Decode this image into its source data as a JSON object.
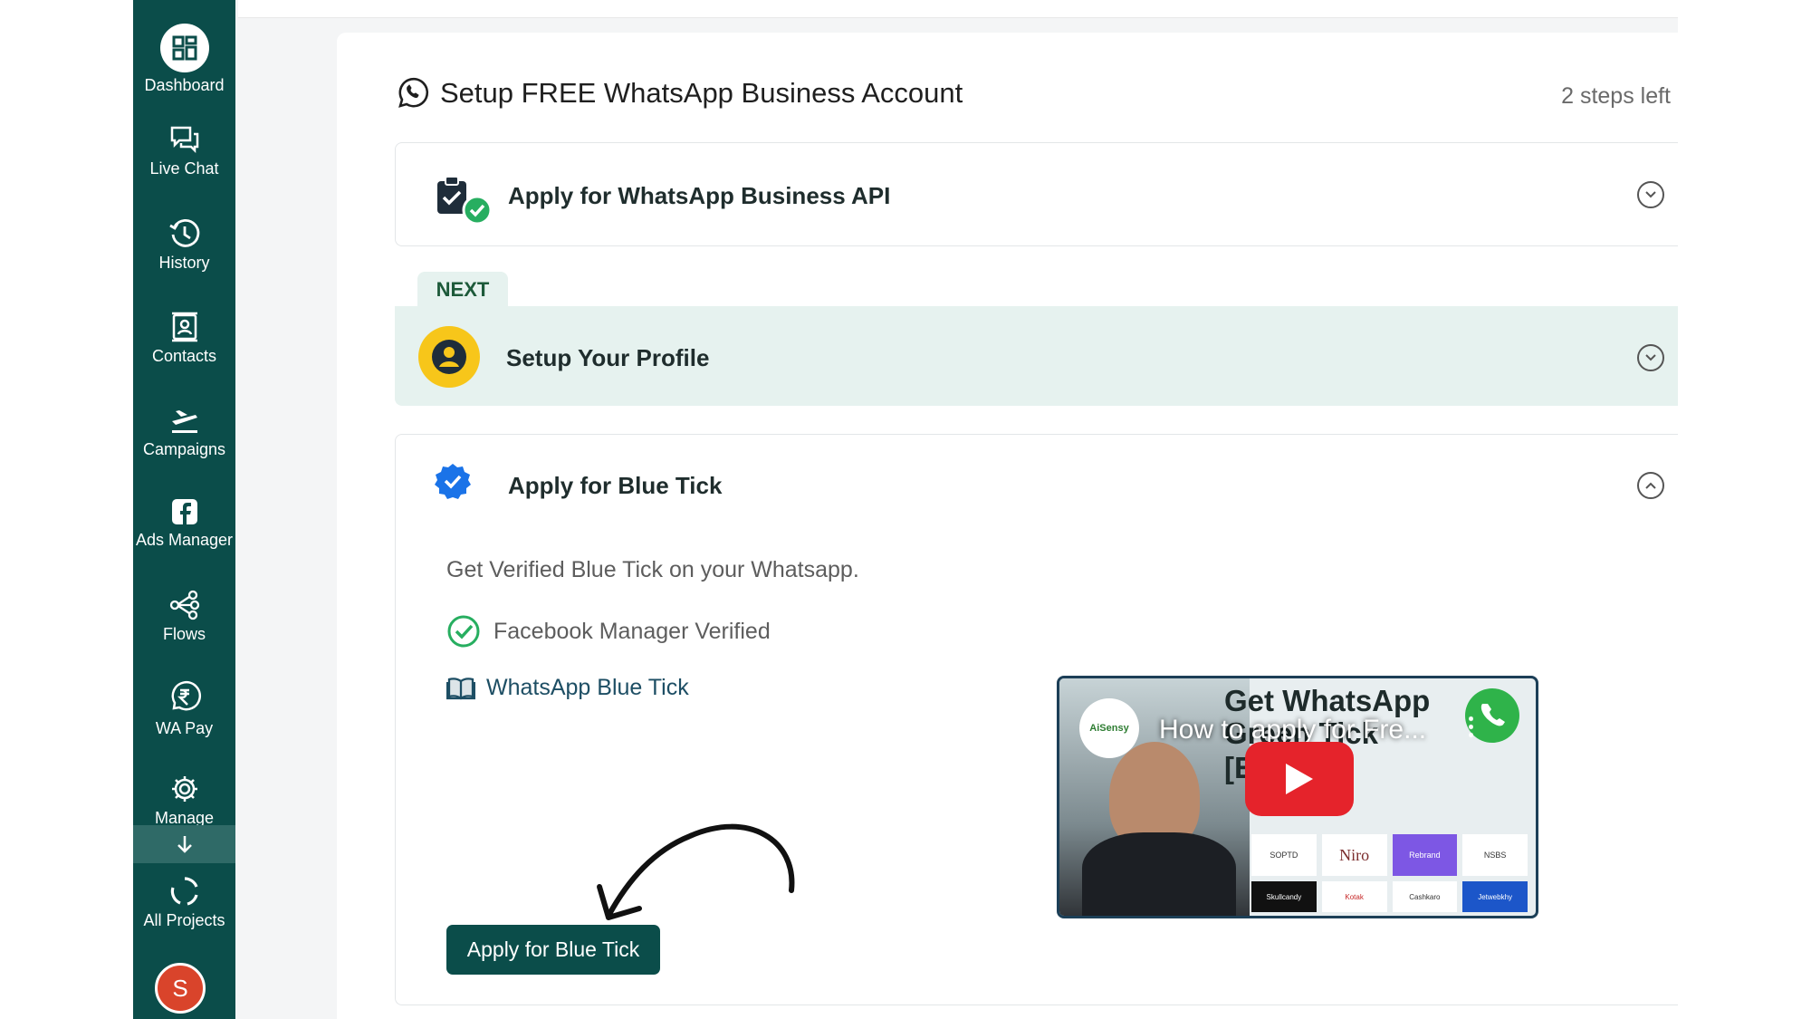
{
  "sidebar": {
    "items": [
      {
        "label": "Dashboard",
        "icon": "dashboard-icon"
      },
      {
        "label": "Live Chat",
        "icon": "chat-icon"
      },
      {
        "label": "History",
        "icon": "history-icon"
      },
      {
        "label": "Contacts",
        "icon": "contacts-icon"
      },
      {
        "label": "Campaigns",
        "icon": "campaigns-icon"
      },
      {
        "label": "Ads Manager",
        "icon": "facebook-icon"
      },
      {
        "label": "Flows",
        "icon": "flows-icon"
      },
      {
        "label": "WA Pay",
        "icon": "rupee-icon"
      },
      {
        "label": "Manage",
        "icon": "gear-icon"
      },
      {
        "label": "All Projects",
        "icon": "projects-icon"
      }
    ],
    "avatar_letter": "S"
  },
  "header": {
    "title": "Setup FREE WhatsApp Business Account",
    "steps_left": "2 steps left"
  },
  "steps": {
    "api": {
      "title": "Apply for WhatsApp Business API"
    },
    "next_badge": "NEXT",
    "profile": {
      "title": "Setup Your Profile"
    },
    "blue_tick": {
      "title": "Apply for Blue Tick",
      "description": "Get Verified Blue Tick on your Whatsapp.",
      "checklist_item": "Facebook Manager Verified",
      "link_label": "WhatsApp Blue Tick",
      "button_label": "Apply for Blue Tick"
    }
  },
  "video": {
    "title": "How to apply for Fre...",
    "thumbnail_heading_1": "Get WhatsApp",
    "thumbnail_heading_2": "Green Tick",
    "thumbnail_heading_3": "[English]",
    "channel": "AiSensy",
    "logos": [
      "SOPTD",
      "Niro",
      "Rebrand",
      "NSBS",
      "Skullcandy",
      "Kotak",
      "Cashkaro",
      "Jetwebkhy"
    ]
  },
  "colors": {
    "sidebar_bg": "#0b4d4a",
    "accent_green": "#27ae60",
    "blue_tick": "#1a73e8",
    "profile_yellow": "#f7c61a",
    "next_bg": "#e6f2ef"
  }
}
